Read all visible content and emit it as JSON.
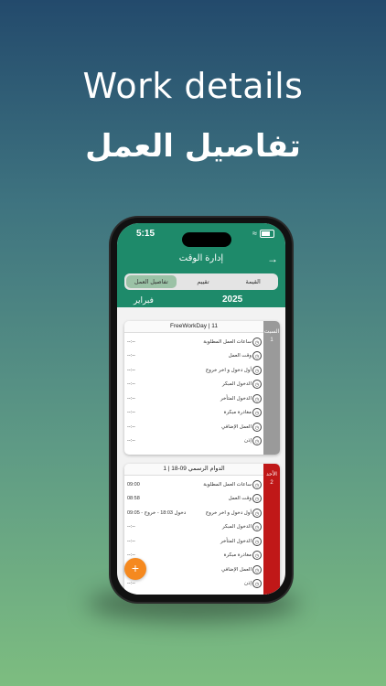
{
  "headline_en": "Work details",
  "headline_ar": "تفاصيل العمل",
  "status": {
    "time": "5:15"
  },
  "header": {
    "title": "إدارة الوقت",
    "tabs": [
      "القيمة",
      "تقييم",
      "تفاصيل العمل"
    ],
    "active_tab": "تفاصيل العمل",
    "year": "2025",
    "month": "فبراير"
  },
  "cards": [
    {
      "header": "FreeWorkDay | 11",
      "stripe_label": "السبت",
      "stripe_number": "1",
      "rows": [
        {
          "label": "ساعات العمل المطلوبة",
          "value": "--:--"
        },
        {
          "label": "وقت العمل",
          "value": "--:--"
        },
        {
          "label": "أول دخول و اخر خروج",
          "value": "--:--"
        },
        {
          "label": "الدخول المبكر",
          "value": "--:--"
        },
        {
          "label": "الدخول المتأخر",
          "value": "--:--"
        },
        {
          "label": "مغادرة مبكرة",
          "value": "--:--"
        },
        {
          "label": "العمل الإضافي",
          "value": "--:--"
        },
        {
          "label": "إذن",
          "value": "--:--"
        }
      ]
    },
    {
      "header": "1 | الدوام الرسمي 09-18",
      "stripe_label": "الأحد",
      "stripe_number": "2",
      "rows": [
        {
          "label": "ساعات العمل المطلوبة",
          "value": "09:00"
        },
        {
          "label": "وقت العمل",
          "value": "08:58"
        },
        {
          "label": "أول دخول و اخر خروج",
          "value": "09:05 - دخول 18:03 - خروج"
        },
        {
          "label": "الدخول المبكر",
          "value": "--:--"
        },
        {
          "label": "الدخول المتأخر",
          "value": "--:--"
        },
        {
          "label": "مغادرة مبكرة",
          "value": "--:--"
        },
        {
          "label": "العمل الإضافي",
          "value": "--:--"
        },
        {
          "label": "إذن",
          "value": "--:--"
        }
      ]
    }
  ],
  "fab_label": "+",
  "colors": {
    "header_green": "#1e8a6a",
    "holiday_stripe": "#9a9a9a",
    "workday_stripe": "#c01818",
    "fab": "#f5891f"
  },
  "icons": [
    "wifi-icon",
    "battery-icon",
    "back-arrow-icon",
    "clock-icon",
    "plus-icon"
  ]
}
